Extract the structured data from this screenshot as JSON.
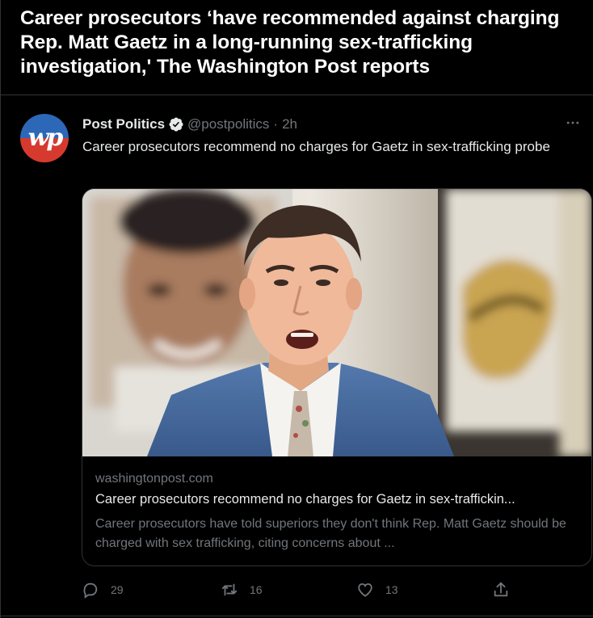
{
  "headline": {
    "line1": "Career prosecutors ‘have recommended against charging",
    "line2": "Rep. Matt Gaetz in a long-running sex-trafficking",
    "line3": "investigation,' The Washington Post reports"
  },
  "tweet": {
    "avatar_text": "wp",
    "author_name": "Post Politics",
    "verified_icon": "verified-badge-icon",
    "handle": "@postpolitics",
    "separator": "·",
    "time": "2h",
    "more_icon": "more-horizontal-icon",
    "text": "Career prosecutors recommend no charges for Gaetz in sex-trafficking probe"
  },
  "card": {
    "image_alt": "Rep. Matt Gaetz speaking in front of a photo of a man",
    "domain": "washingtonpost.com",
    "title": "Career prosecutors recommend no charges for Gaetz in sex-traffickin...",
    "description": "Career prosecutors have told superiors they don't think Rep. Matt Gaetz should be charged with sex trafficking, citing concerns about ..."
  },
  "actions": {
    "reply_count": "29",
    "retweet_count": "16",
    "like_count": "13"
  },
  "colors": {
    "background": "#000000",
    "text_primary": "#e7e9ea",
    "text_secondary": "#71767b",
    "border": "#2f3336"
  }
}
